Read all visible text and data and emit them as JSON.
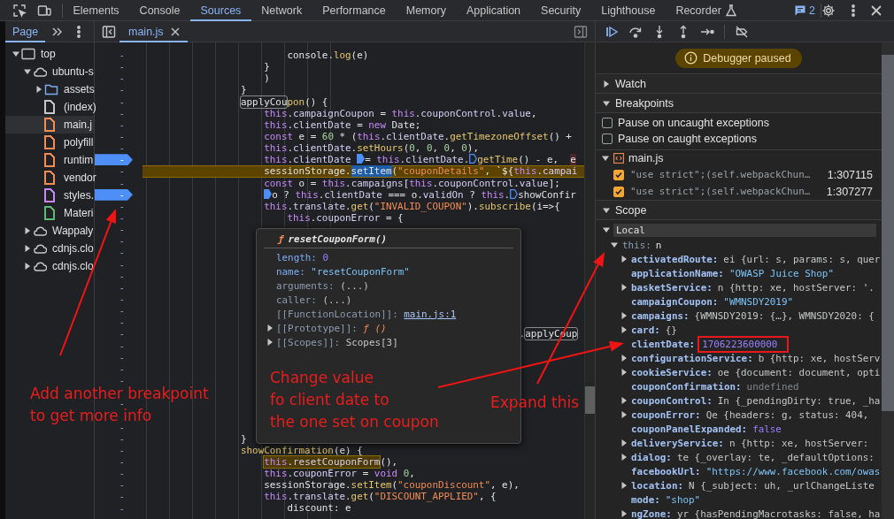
{
  "devtools_tabs": [
    {
      "label": "Elements",
      "selected": false,
      "experimental": false
    },
    {
      "label": "Console",
      "selected": false,
      "experimental": false
    },
    {
      "label": "Sources",
      "selected": true,
      "experimental": false
    },
    {
      "label": "Network",
      "selected": false,
      "experimental": false
    },
    {
      "label": "Performance",
      "selected": false,
      "experimental": false
    },
    {
      "label": "Memory",
      "selected": false,
      "experimental": false
    },
    {
      "label": "Application",
      "selected": false,
      "experimental": false
    },
    {
      "label": "Security",
      "selected": false,
      "experimental": false
    },
    {
      "label": "Lighthouse",
      "selected": false,
      "experimental": false
    },
    {
      "label": "Recorder",
      "selected": false,
      "experimental": true
    }
  ],
  "issues_count": "2",
  "navigator": {
    "tab": {
      "label": "Page",
      "selected": true
    },
    "tree": [
      {
        "label": "top",
        "kind": "frame",
        "expanded": true,
        "selected": false,
        "children": [
          {
            "label": "ubuntu-s",
            "kind": "origin",
            "expanded": true,
            "selected": false,
            "children": [
              {
                "label": "assets",
                "kind": "folder",
                "expanded": false,
                "selected": false
              },
              {
                "label": "(index)",
                "kind": "file",
                "color": "#c4c7c5",
                "selected": false
              },
              {
                "label": "main.j",
                "kind": "file",
                "color": "#f28b54",
                "selected": true
              },
              {
                "label": "polyfill",
                "kind": "file",
                "color": "#f28b54",
                "selected": false
              },
              {
                "label": "runtim",
                "kind": "file",
                "color": "#f28b54",
                "selected": false
              },
              {
                "label": "vendor",
                "kind": "file",
                "color": "#f28b54",
                "selected": false
              },
              {
                "label": "styles.",
                "kind": "file",
                "color": "#c58af9",
                "selected": false
              },
              {
                "label": "Materi",
                "kind": "file",
                "color": "#5bb974",
                "selected": false
              }
            ]
          },
          {
            "label": "Wappaly",
            "kind": "origin",
            "expanded": false,
            "selected": false
          },
          {
            "label": "cdnjs.clo",
            "kind": "origin",
            "expanded": false,
            "selected": false
          },
          {
            "label": "cdnjs.clo",
            "kind": "origin",
            "expanded": false,
            "selected": false
          }
        ]
      }
    ]
  },
  "editor": {
    "tab": {
      "label": "main.js",
      "selected": true
    },
    "rows": [
      {
        "number": "-",
        "breakpoint": false,
        "paused": false,
        "parts": [
          {
            "kind": "text",
            "text": "        console.log(e)"
          }
        ]
      },
      {
        "number": "-",
        "breakpoint": false,
        "paused": false,
        "parts": [
          {
            "kind": "text",
            "text": "    }"
          }
        ]
      },
      {
        "number": "-",
        "breakpoint": false,
        "paused": false,
        "parts": [
          {
            "kind": "text",
            "text": "    )"
          }
        ]
      },
      {
        "number": "-",
        "breakpoint": false,
        "paused": false,
        "parts": [
          {
            "kind": "text",
            "text": "}"
          }
        ]
      },
      {
        "number": "-",
        "breakpoint": false,
        "paused": false,
        "parts": [
          {
            "kind": "search",
            "text": "applyCou"
          },
          {
            "kind": "text",
            "text": "pon() {"
          }
        ]
      },
      {
        "number": "-",
        "breakpoint": false,
        "paused": false,
        "parts": [
          {
            "kind": "text",
            "text": "    this.campaignCoupon = this.couponControl.value,"
          }
        ]
      },
      {
        "number": "-",
        "breakpoint": false,
        "paused": false,
        "parts": [
          {
            "kind": "text",
            "text": "    this.clientDate = new Date;"
          }
        ]
      },
      {
        "number": "-",
        "breakpoint": false,
        "paused": false,
        "parts": [
          {
            "kind": "text",
            "text": "    const e = 60 * (this.clientDate.getTimezoneOffset() +"
          }
        ]
      },
      {
        "number": "-",
        "breakpoint": false,
        "paused": false,
        "parts": [
          {
            "kind": "text",
            "text": "    this.clientDate.setHours(0, 0, 0, 0),"
          }
        ]
      },
      {
        "number": "-",
        "breakpoint": true,
        "paused": false,
        "parts": [
          {
            "kind": "text",
            "text": "    this.clientDate "
          },
          {
            "kind": "marker",
            "active": true
          },
          {
            "kind": "text",
            "text": "= this.clientDate."
          },
          {
            "kind": "marker",
            "active": false
          },
          {
            "kind": "text",
            "text": "getTime() - e,  "
          },
          {
            "kind": "inline-value",
            "text": "e"
          }
        ]
      },
      {
        "number": "-",
        "breakpoint": false,
        "paused": true,
        "parts": [
          {
            "kind": "text",
            "text": "    sessionStorage."
          },
          {
            "kind": "selection",
            "text": "setItem"
          },
          {
            "kind": "text",
            "text": "(\"couponDetails\", `${this.campai"
          }
        ]
      },
      {
        "number": "-",
        "breakpoint": false,
        "paused": false,
        "parts": [
          {
            "kind": "text",
            "text": "    const o = this.campaigns[this.couponControl.value];"
          }
        ]
      },
      {
        "number": "-",
        "breakpoint": true,
        "paused": false,
        "parts": [
          {
            "kind": "marker",
            "active": true
          },
          {
            "kind": "text",
            "text": "    o ? this.clientDate === o.validOn ? this."
          },
          {
            "kind": "marker",
            "active": false
          },
          {
            "kind": "text",
            "text": "showConfir"
          }
        ]
      },
      {
        "number": "-",
        "breakpoint": false,
        "paused": false,
        "parts": [
          {
            "kind": "text",
            "text": "    this.translate.get(\"INVALID_COUPON\").subscribe(i=>{"
          }
        ]
      },
      {
        "number": "-",
        "breakpoint": false,
        "paused": false,
        "parts": [
          {
            "kind": "text",
            "text": "        this.couponError = {"
          }
        ]
      },
      {
        "number": "-",
        "breakpoint": false,
        "paused": false
      },
      {
        "number": "-",
        "breakpoint": false,
        "paused": false
      },
      {
        "number": "-",
        "breakpoint": false,
        "paused": false
      },
      {
        "number": "-",
        "breakpoint": false,
        "paused": false
      },
      {
        "number": "-",
        "breakpoint": false,
        "paused": false
      },
      {
        "number": "-",
        "breakpoint": false,
        "paused": false
      },
      {
        "number": "-",
        "breakpoint": false,
        "paused": false
      },
      {
        "number": "-",
        "breakpoint": false,
        "paused": false
      },
      {
        "number": "-",
        "breakpoint": false,
        "paused": false
      },
      {
        "number": "-",
        "breakpoint": false,
        "paused": false,
        "parts": [
          {
            "kind": "text",
            "text": "                                                ."
          },
          {
            "kind": "search",
            "text": "applyCoup"
          }
        ]
      },
      {
        "number": "-",
        "breakpoint": false,
        "paused": false
      },
      {
        "number": "-",
        "breakpoint": false,
        "paused": false
      },
      {
        "number": "-",
        "breakpoint": false,
        "paused": false
      },
      {
        "number": "-",
        "breakpoint": false,
        "paused": false
      },
      {
        "breakpoint": false,
        "paused": false
      },
      {
        "number": "-",
        "breakpoint": false,
        "paused": false
      },
      {
        "breakpoint": false,
        "paused": false
      },
      {
        "number": "-",
        "breakpoint": false,
        "paused": false
      },
      {
        "number": "-",
        "breakpoint": false,
        "paused": false,
        "parts": [
          {
            "kind": "text",
            "text": "}"
          }
        ]
      },
      {
        "number": "-",
        "breakpoint": false,
        "paused": false,
        "parts": [
          {
            "kind": "text",
            "text": "showConfirmation(e) {"
          }
        ]
      },
      {
        "number": "-",
        "breakpoint": false,
        "paused": false,
        "parts": [
          {
            "kind": "hover",
            "text": "    this.resetCouponForm"
          },
          {
            "kind": "text",
            "text": "(),"
          }
        ]
      },
      {
        "number": "-",
        "breakpoint": false,
        "paused": false,
        "parts": [
          {
            "kind": "text",
            "text": "    this.couponError = void 0,"
          }
        ]
      },
      {
        "number": "-",
        "breakpoint": false,
        "paused": false,
        "parts": [
          {
            "kind": "text",
            "text": "    sessionStorage.setItem(\"couponDiscount\", e),"
          }
        ]
      },
      {
        "number": "-",
        "breakpoint": false,
        "paused": false,
        "parts": [
          {
            "kind": "text",
            "text": "    this.translate.get(\"DISCOUNT_APPLIED\", {"
          }
        ]
      },
      {
        "number": "-",
        "breakpoint": false,
        "paused": false,
        "parts": [
          {
            "kind": "text",
            "text": "        discount: e"
          }
        ]
      }
    ],
    "popover": {
      "glyph": "ƒ",
      "title": "resetCouponForm()",
      "properties": [
        {
          "key": "length:",
          "value": "0",
          "kind": "number",
          "internal": false,
          "has_children": false
        },
        {
          "key": "name:",
          "value": "\"resetCouponForm\"",
          "kind": "string",
          "internal": false,
          "has_children": false
        },
        {
          "key": "arguments:",
          "value": "(...)",
          "kind": "getter",
          "internal": true,
          "has_children": false
        },
        {
          "key": "caller:",
          "value": "(...)",
          "kind": "getter",
          "internal": true,
          "has_children": false
        },
        {
          "key": "[[FunctionLocation]]:",
          "value": "main.js:1",
          "kind": "link",
          "internal": true,
          "has_children": false
        },
        {
          "key": "[[Prototype]]:",
          "value": "ƒ ()",
          "kind": "function",
          "internal": true,
          "has_children": true
        },
        {
          "key": "[[Scopes]]:",
          "value": "Scopes[3]",
          "kind": "object",
          "internal": true,
          "has_children": true
        }
      ]
    }
  },
  "debugger": {
    "banner": "Debugger paused",
    "watch": {
      "title": "Watch",
      "expanded": false
    },
    "breakpoints": {
      "title": "Breakpoints",
      "expanded": true,
      "options": [
        {
          "label": "Pause on uncaught exceptions",
          "checked": false
        },
        {
          "label": "Pause on caught exceptions",
          "checked": false
        }
      ],
      "files": [
        {
          "name": "main.js",
          "expanded": true,
          "items": [
            {
              "code": "\"use strict\";(self.webpackChun…",
              "location": "1:307115",
              "checked": true
            },
            {
              "code": "\"use strict\";(self.webpackChun…",
              "location": "1:307277",
              "checked": true
            }
          ]
        }
      ]
    },
    "scope": {
      "title": "Scope",
      "expanded": true,
      "local": {
        "label": "Local",
        "expanded": true,
        "object": {
          "key": "this:",
          "value": "n",
          "expanded": true,
          "properties": [
            {
              "key": "activatedRoute:",
              "value": "ei {url: s, params: s, quer",
              "kind": "object",
              "has_children": true,
              "boxed": false
            },
            {
              "key": "applicationName:",
              "value": "\"OWASP Juice Shop\"",
              "kind": "string",
              "has_children": false,
              "boxed": false
            },
            {
              "key": "basketService:",
              "value": "n {http: xe, hostServer: '.",
              "kind": "object",
              "has_children": true,
              "boxed": false
            },
            {
              "key": "campaignCoupon:",
              "value": "\"WMNSDY2019\"",
              "kind": "string",
              "has_children": false,
              "boxed": false
            },
            {
              "key": "campaigns:",
              "value": "{WMNSDY2019: {…}, WMNSDY2020: {",
              "kind": "object",
              "has_children": true,
              "boxed": false
            },
            {
              "key": "card:",
              "value": "{}",
              "kind": "object",
              "has_children": true,
              "boxed": false
            },
            {
              "key": "clientDate:",
              "value": "1706223600000",
              "kind": "number",
              "has_children": false,
              "boxed": true
            },
            {
              "key": "configurationService:",
              "value": "b {http: xe, hostServ",
              "kind": "object",
              "has_children": true,
              "boxed": false
            },
            {
              "key": "cookieService:",
              "value": "oe {document: document, opti",
              "kind": "object",
              "has_children": true,
              "boxed": false
            },
            {
              "key": "couponConfirmation:",
              "value": "undefined",
              "kind": "undefined",
              "has_children": false,
              "boxed": false
            },
            {
              "key": "couponControl:",
              "value": "In {_pendingDirty: true, _ha",
              "kind": "object",
              "has_children": true,
              "boxed": false
            },
            {
              "key": "couponError:",
              "value": "Qe {headers: g, status: 404,",
              "kind": "object",
              "has_children": true,
              "boxed": false
            },
            {
              "key": "couponPanelExpanded:",
              "value": "false",
              "kind": "boolean",
              "has_children": false,
              "boxed": false
            },
            {
              "key": "deliveryService:",
              "value": "n {http: xe, hostServer:",
              "kind": "object",
              "has_children": true,
              "boxed": false
            },
            {
              "key": "dialog:",
              "value": "te {_overlay: te, _defaultOptions:",
              "kind": "object",
              "has_children": true,
              "boxed": false
            },
            {
              "key": "facebookUrl:",
              "value": "\"https://www.facebook.com/owas",
              "kind": "string",
              "has_children": false,
              "boxed": false
            },
            {
              "key": "location:",
              "value": "N {_subject: uh, _urlChangeListe",
              "kind": "object",
              "has_children": true,
              "boxed": false
            },
            {
              "key": "mode:",
              "value": "\"shop\"",
              "kind": "string",
              "has_children": false,
              "boxed": false
            },
            {
              "key": "ngZone:",
              "value": "yr {hasPendingMacrotasks: false, ha",
              "kind": "object",
              "has_children": true,
              "boxed": false
            }
          ]
        }
      }
    }
  },
  "annotations": [
    {
      "lines": [
        "Add another breakpoint",
        "to get more info"
      ]
    },
    {
      "lines": [
        "Change value",
        "fo client date to",
        "the one set on coupon"
      ]
    },
    {
      "lines": [
        "Expand this"
      ]
    }
  ]
}
